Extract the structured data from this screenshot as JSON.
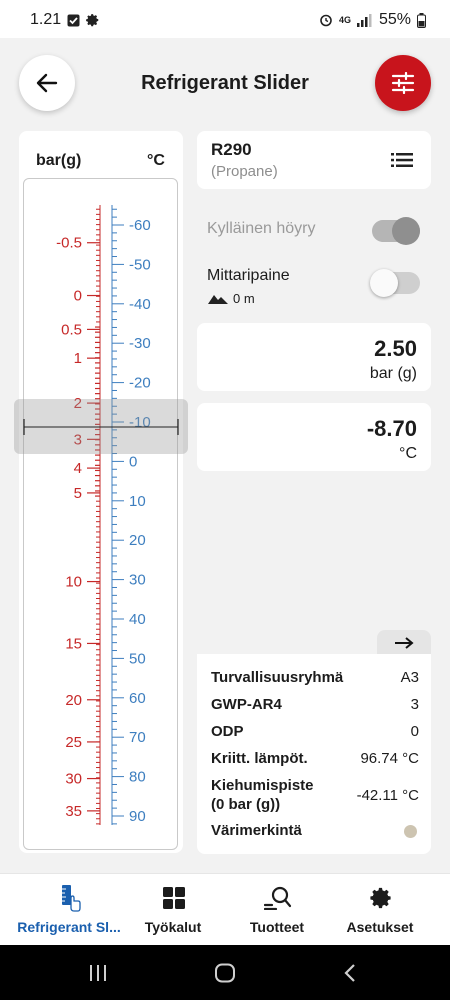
{
  "status_bar": {
    "time": "1.21",
    "network": "4G",
    "battery": "55%"
  },
  "header": {
    "title": "Refrigerant Slider",
    "back_icon": "arrow-left-icon",
    "menu_icon": "sliders-icon",
    "menu_color": "#c8141c"
  },
  "slider": {
    "unit_left": "bar(g)",
    "unit_right": "°C",
    "pressure_labels": [
      "-0.5",
      "0",
      "0.5",
      "1",
      "2",
      "3",
      "4",
      "5",
      "10",
      "15",
      "20",
      "25",
      "30",
      "35"
    ],
    "temperature_labels": [
      "-60",
      "-50",
      "-40",
      "-30",
      "-20",
      "-10",
      "0",
      "10",
      "20",
      "30",
      "40",
      "50",
      "60",
      "70",
      "80",
      "90"
    ],
    "pressure_color": "#c62828",
    "temperature_color": "#3d7ebf"
  },
  "refrigerant": {
    "name": "R290",
    "subtitle": "(Propane)",
    "list_icon": "list-icon"
  },
  "toggles": {
    "saturated_vapor": {
      "label": "Kylläinen höyry",
      "on": true
    },
    "gauge_pressure": {
      "label": "Mittaripaine",
      "on": false
    },
    "altitude": "0 m"
  },
  "pressure": {
    "value": "2.50",
    "unit": "bar (g)"
  },
  "temperature": {
    "value": "-8.70",
    "unit": "°C"
  },
  "info": {
    "arrow_icon": "arrow-right-icon",
    "rows": [
      {
        "key": "Turvallisuusryhmä",
        "value": "A3"
      },
      {
        "key": "GWP-AR4",
        "value": "3"
      },
      {
        "key": "ODP",
        "value": "0"
      },
      {
        "key": "Kriitt. lämpöt.",
        "value": "96.74 °C"
      },
      {
        "key": "Kiehumispiste (0 bar (g))",
        "value": "-42.11 °C"
      },
      {
        "key": "Värimerkintä",
        "value": ""
      }
    ],
    "color_marking": "#cdc4b1"
  },
  "nav": {
    "items": [
      {
        "label": "Refrigerant Sl...",
        "icon": "ruler-hand-icon",
        "active": true
      },
      {
        "label": "Työkalut",
        "icon": "grid-icon",
        "active": false
      },
      {
        "label": "Tuotteet",
        "icon": "search-list-icon",
        "active": false
      },
      {
        "label": "Asetukset",
        "icon": "gear-icon",
        "active": false
      }
    ]
  }
}
